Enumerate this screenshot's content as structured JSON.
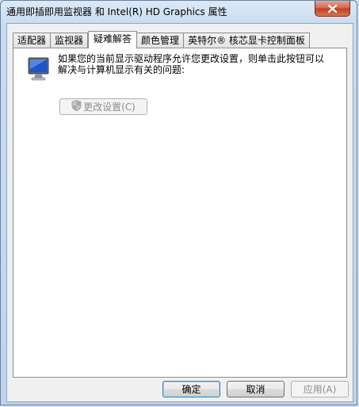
{
  "window": {
    "title": "通用即插即用监视器 和 Intel(R) HD Graphics 属性",
    "close_icon": "close-icon"
  },
  "tabs": [
    {
      "label": "适配器",
      "active": false
    },
    {
      "label": "监视器",
      "active": false
    },
    {
      "label": "疑难解答",
      "active": true
    },
    {
      "label": "颜色管理",
      "active": false
    },
    {
      "label": "英特尔® 核芯显卡控制面板",
      "active": false
    }
  ],
  "troubleshoot": {
    "icon": "monitor-icon",
    "message": "如果您的当前显示驱动程序允许您更改设置，则单击此按钮可以解决与计算机显示有关的问题:",
    "change_settings_label": "更改设置(C)",
    "change_settings_enabled": false,
    "shield_icon": "uac-shield-icon"
  },
  "footer": {
    "ok_label": "确定",
    "cancel_label": "取消",
    "apply_label": "应用(A)",
    "apply_enabled": false
  }
}
